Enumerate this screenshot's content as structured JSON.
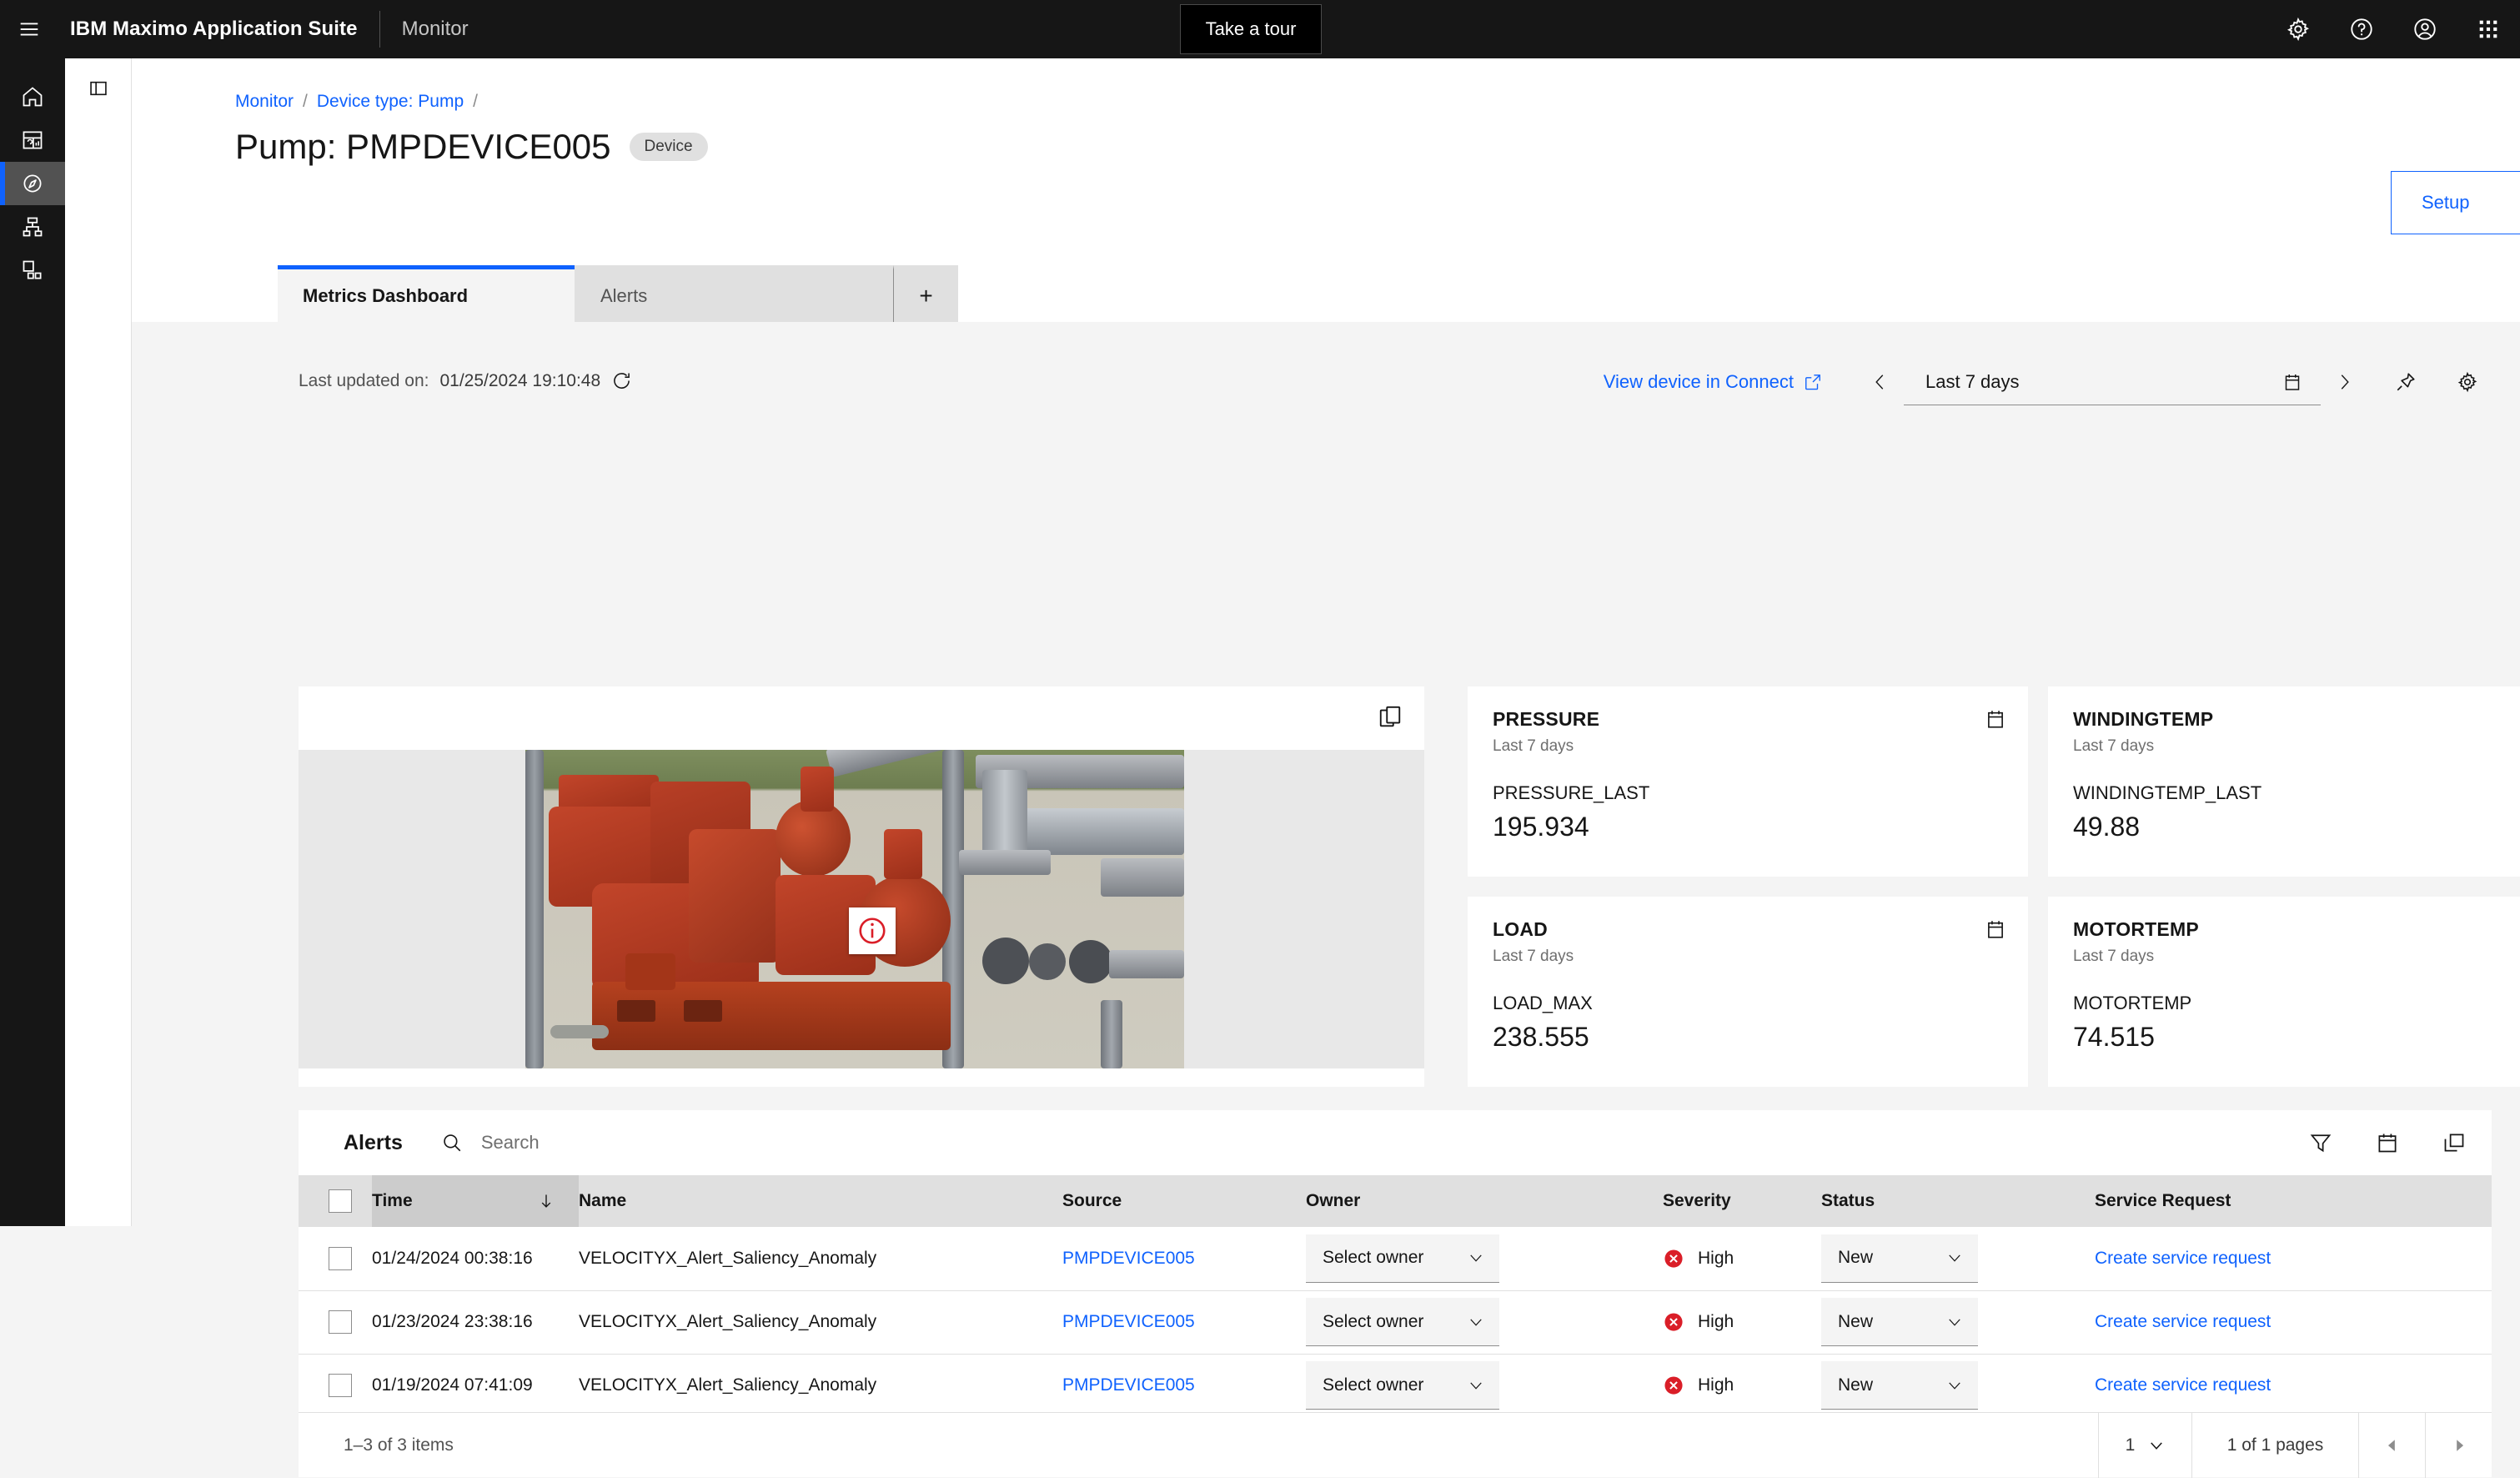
{
  "header": {
    "menu_icon": "hamburger-icon",
    "brand": "IBM Maximo Application Suite",
    "module": "Monitor",
    "tour_button": "Take a tour",
    "actions": [
      {
        "name": "settings-icon",
        "label": "Settings"
      },
      {
        "name": "help-icon",
        "label": "Help"
      },
      {
        "name": "user-avatar-icon",
        "label": "Profile"
      },
      {
        "name": "app-switcher-icon",
        "label": "App switcher"
      }
    ]
  },
  "sidebar": {
    "items": [
      {
        "name": "home-icon",
        "label": "Home",
        "active": false
      },
      {
        "name": "dashboard-icon",
        "label": "Dashboard",
        "active": false
      },
      {
        "name": "monitor-compass-icon",
        "label": "Monitor",
        "active": true
      },
      {
        "name": "hierarchy-icon",
        "label": "Hierarchy",
        "active": false
      },
      {
        "name": "assets-icon",
        "label": "Assets",
        "active": false
      }
    ]
  },
  "breadcrumb": {
    "items": [
      "Monitor",
      "Device type: Pump"
    ],
    "sep": "/"
  },
  "page": {
    "title": "Pump: PMPDEVICE005",
    "type_tag": "Device",
    "setup_button": "Setup"
  },
  "tabs": [
    {
      "label": "Metrics Dashboard",
      "selected": true
    },
    {
      "label": "Alerts",
      "selected": false
    },
    {
      "label": "+",
      "selected": false
    }
  ],
  "toolbar": {
    "last_updated_label": "Last updated on:",
    "last_updated_value": "01/25/2024 19:10:48",
    "refresh_icon": "refresh-icon",
    "connect_link": "View device in Connect",
    "range_value": "Last 7 days",
    "prev_icon": "chevron-left-icon",
    "next_icon": "chevron-right-icon",
    "calendar_icon": "calendar-icon",
    "pin_icon": "pin-icon",
    "gear_icon": "gear-icon"
  },
  "image_card": {
    "expand_icon": "expand-image-icon",
    "marker_icon": "information-icon",
    "alt": "Industrial red centrifugal pump with grey piping"
  },
  "metrics": [
    {
      "title": "PRESSURE",
      "range": "Last 7 days",
      "label": "PRESSURE_LAST",
      "value": "195.934",
      "icon": "calendar-icon"
    },
    {
      "title": "WINDINGTEMP",
      "range": "Last 7 days",
      "label": "WINDINGTEMP_LAST",
      "value": "49.88",
      "icon": "calendar-icon"
    },
    {
      "title": "LOAD",
      "range": "Last 7 days",
      "label": "LOAD_MAX",
      "value": "238.555",
      "icon": "calendar-icon"
    },
    {
      "title": "MOTORTEMP",
      "range": "Last 7 days",
      "label": "MOTORTEMP",
      "value": "74.515",
      "icon": "calendar-icon"
    }
  ],
  "alerts": {
    "title": "Alerts",
    "search_placeholder": "Search",
    "search_value": "",
    "toolbar_icons": [
      {
        "name": "filter-icon"
      },
      {
        "name": "calendar-icon"
      },
      {
        "name": "open-in-new-icon"
      }
    ],
    "columns": [
      {
        "key": "time",
        "label": "Time",
        "sorted": true,
        "sort_dir": "desc"
      },
      {
        "key": "name",
        "label": "Name",
        "sorted": false
      },
      {
        "key": "source",
        "label": "Source",
        "sorted": false
      },
      {
        "key": "owner",
        "label": "Owner",
        "sorted": false
      },
      {
        "key": "severity",
        "label": "Severity",
        "sorted": false
      },
      {
        "key": "status",
        "label": "Status",
        "sorted": false
      },
      {
        "key": "sr",
        "label": "Service Request",
        "sorted": false
      }
    ],
    "rows": [
      {
        "time": "01/24/2024 00:38:16",
        "name": "VELOCITYX_Alert_Saliency_Anomaly",
        "source": "PMPDEVICE005",
        "owner": "Select owner",
        "severity": "High",
        "severity_color": "#da1e28",
        "status": "New",
        "service_request": "Create service request"
      },
      {
        "time": "01/23/2024 23:38:16",
        "name": "VELOCITYX_Alert_Saliency_Anomaly",
        "source": "PMPDEVICE005",
        "owner": "Select owner",
        "severity": "High",
        "severity_color": "#da1e28",
        "status": "New",
        "service_request": "Create service request"
      },
      {
        "time": "01/19/2024 07:41:09",
        "name": "VELOCITYX_Alert_Saliency_Anomaly",
        "source": "PMPDEVICE005",
        "owner": "Select owner",
        "severity": "High",
        "severity_color": "#da1e28",
        "status": "New",
        "service_request": "Create service request"
      }
    ],
    "footer": {
      "count": "1–3 of 3 items",
      "page_number": "1",
      "pages_label": "1 of 1 pages"
    }
  },
  "colors": {
    "accent": "#0f62fe",
    "header_bg": "#161616",
    "danger": "#da1e28",
    "page_bg": "#f4f4f4"
  }
}
